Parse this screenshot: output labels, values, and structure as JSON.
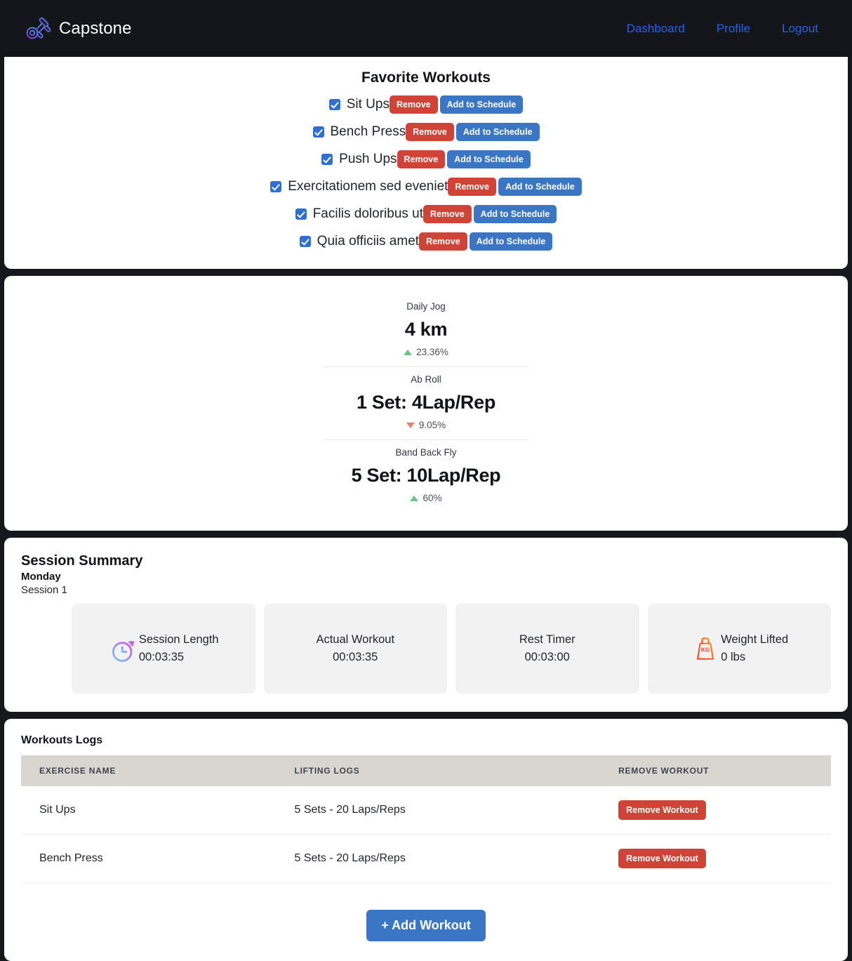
{
  "navbar": {
    "brand": "Capstone",
    "logo_icon": "dumbbell-icon",
    "links": [
      {
        "label": "Dashboard"
      },
      {
        "label": "Profile"
      },
      {
        "label": "Logout"
      }
    ]
  },
  "favorites": {
    "title": "Favorite Workouts",
    "remove_label": "Remove",
    "add_label": "Add to Schedule",
    "items": [
      {
        "name": "Sit Ups",
        "checked": true
      },
      {
        "name": "Bench Press",
        "checked": true
      },
      {
        "name": "Push Ups",
        "checked": true
      },
      {
        "name": "Exercitationem sed eveniet",
        "checked": true
      },
      {
        "name": "Facilis doloribus ut",
        "checked": true
      },
      {
        "name": "Quia officiis amet",
        "checked": true
      }
    ]
  },
  "stats": {
    "items": [
      {
        "label": "Daily Jog",
        "value": "4 km",
        "delta": "23.36%",
        "direction": "up"
      },
      {
        "label": "Ab Roll",
        "value": "1 Set: 4Lap/Rep",
        "delta": "9.05%",
        "direction": "down"
      },
      {
        "label": "Band Back Fly",
        "value": "5 Set: 10Lap/Rep",
        "delta": "60%",
        "direction": "up"
      }
    ],
    "up_color": "#6fc08a",
    "down_color": "#e87b6b"
  },
  "session_summary": {
    "title": "Session Summary",
    "day": "Monday",
    "session": "Session 1",
    "tiles": [
      {
        "label": "Session Length",
        "value": "00:03:35",
        "icon": "stopwatch-icon"
      },
      {
        "label": "Actual Workout",
        "value": "00:03:35",
        "icon": "none"
      },
      {
        "label": "Rest Timer",
        "value": "00:03:00",
        "icon": "none"
      },
      {
        "label": "Weight Lifted",
        "value": "0 lbs",
        "icon": "weight-kg-icon"
      }
    ]
  },
  "logs": {
    "title": "Workouts Logs",
    "columns": [
      "EXERCISE NAME",
      "LIFTING LOGS",
      "REMOVE WORKOUT"
    ],
    "rows": [
      {
        "name": "Sit Ups",
        "lifting": "5 Sets - 20 Laps/Reps",
        "action": "Remove Workout"
      },
      {
        "name": "Bench Press",
        "lifting": "5 Sets - 20 Laps/Reps",
        "action": "Remove Workout"
      }
    ],
    "add_button": "+ Add Workout"
  },
  "colors": {
    "nav_background": "#14141b",
    "nav_link": "#2563eb",
    "danger": "#cf4436",
    "primary": "#3b76c4",
    "table_header": "#d9d5cf",
    "tile_background": "#f2f2f2"
  }
}
